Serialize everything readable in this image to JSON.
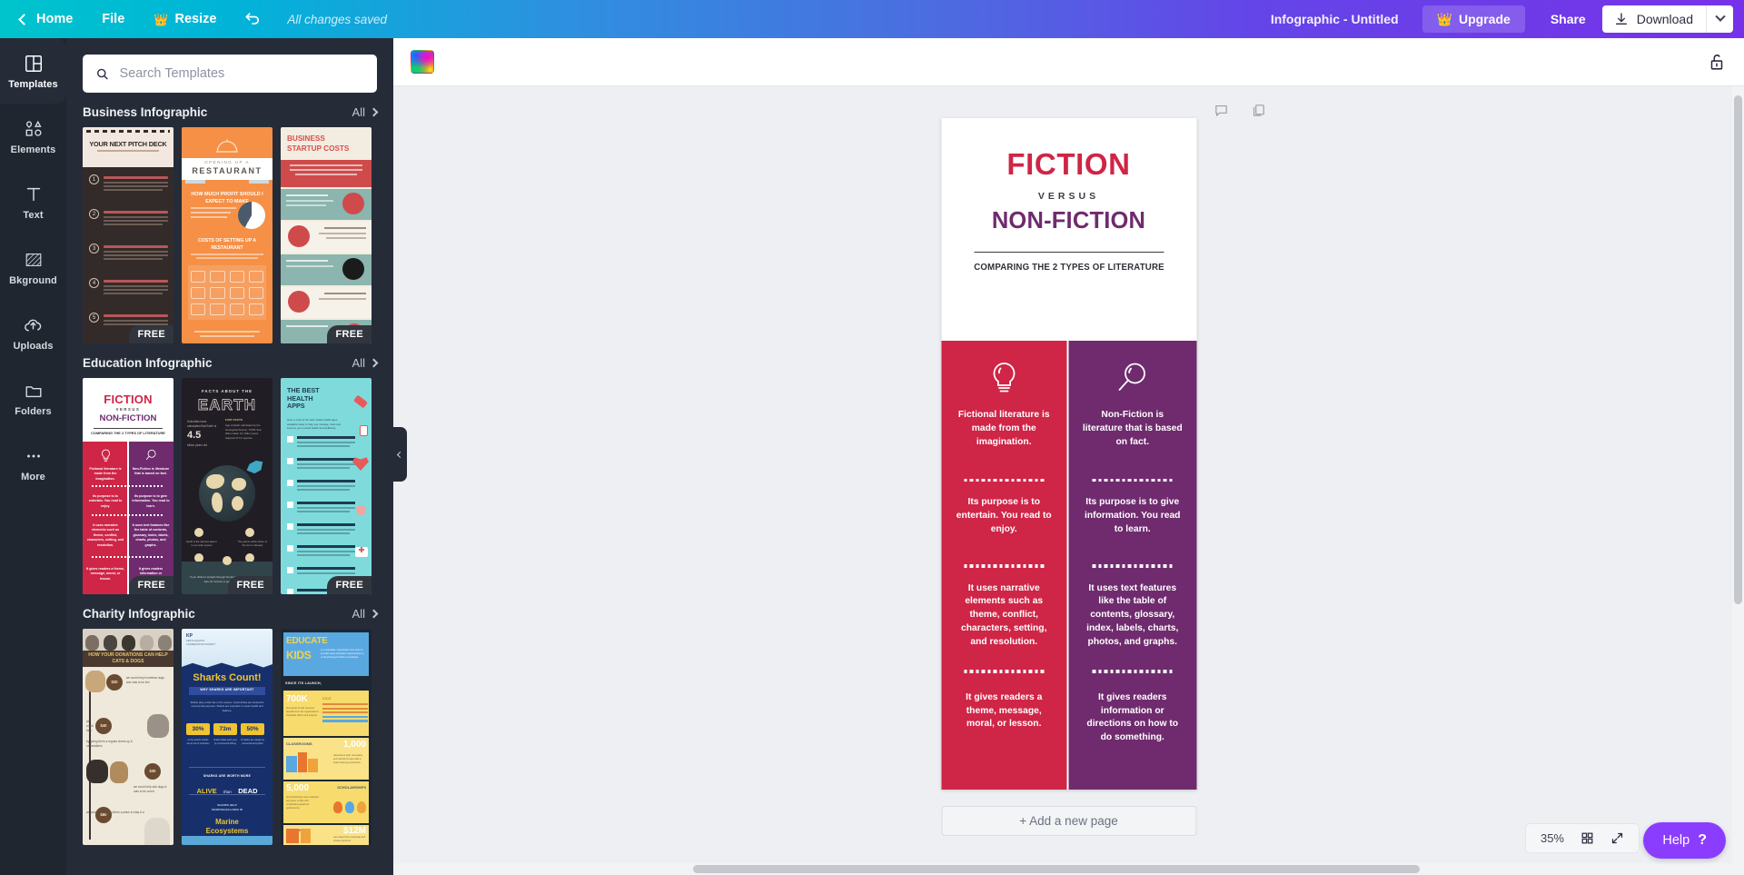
{
  "topbar": {
    "back_label": "Home",
    "file_label": "File",
    "resize_label": "Resize",
    "saved_status": "All changes saved",
    "doc_title": "Infographic - Untitled",
    "upgrade_label": "Upgrade",
    "share_label": "Share",
    "download_label": "Download",
    "gradient_start": "#00c4cc",
    "gradient_end": "#7632e8"
  },
  "rail": {
    "items": [
      {
        "label": "Templates",
        "icon": "templates-icon",
        "active": true
      },
      {
        "label": "Elements",
        "icon": "elements-icon",
        "active": false
      },
      {
        "label": "Text",
        "icon": "text-icon",
        "active": false
      },
      {
        "label": "Bkground",
        "icon": "background-icon",
        "active": false
      },
      {
        "label": "Uploads",
        "icon": "uploads-icon",
        "active": false
      },
      {
        "label": "Folders",
        "icon": "folders-icon",
        "active": false
      },
      {
        "label": "More",
        "icon": "more-icon",
        "active": false
      }
    ]
  },
  "panel": {
    "search": {
      "value": "",
      "placeholder": "Search Templates"
    },
    "all_label": "All",
    "free_badge": "FREE",
    "sections": [
      {
        "title": "Business Infographic",
        "templates": [
          {
            "name": "Your Next Pitch Deck",
            "free": true
          },
          {
            "name": "Opening Up A Restaurant",
            "free": false
          },
          {
            "name": "Business Startup Costs",
            "free": true
          }
        ]
      },
      {
        "title": "Education Infographic",
        "templates": [
          {
            "name": "Fiction Versus Non-Fiction",
            "free": true
          },
          {
            "name": "Facts About The Earth",
            "free": true
          },
          {
            "name": "The Best Health Apps",
            "free": true
          }
        ]
      },
      {
        "title": "Charity Infographic",
        "templates": [
          {
            "name": "How Your Donations Can Help Cats & Dogs",
            "free": false
          },
          {
            "name": "Sharks Count!",
            "free": false
          },
          {
            "name": "Educate Kids",
            "free": false
          }
        ]
      }
    ],
    "thumb_text": {
      "pitch_title": "YOUR NEXT PITCH DECK",
      "restaurant_title": "RESTAURANT",
      "restaurant_kicker": "OPENING UP A",
      "startup_title_1": "BUSINESS",
      "startup_title_2": "STARTUP COSTS",
      "fiction_title": "FICTION",
      "fiction_versus": "VERSUS",
      "fiction_non": "NON-FICTION",
      "fiction_sub": "COMPARING THE 2 TYPES OF LITERATURE",
      "earth_kicker": "FACTS ABOUT THE",
      "earth_title": "EARTH",
      "earth_value": "4.5",
      "health_title": "THE BEST\nHEALTH\nAPPS",
      "cats_title": "HOW YOUR DONATIONS CAN HELP CATS & DOGS",
      "sharks_title": "Sharks Count!",
      "sharks_sub": "WHY SHARKS ARE IMPORTANT",
      "sharks_stat1": "30%",
      "sharks_stat2": "73m",
      "sharks_stat3": "50%",
      "sharks_alive": "ALIVE",
      "sharks_than": "than",
      "sharks_dead": "DEAD",
      "sharks_marine": "Marine",
      "sharks_eco": "Ecosystems",
      "educate_1": "EDUCATE",
      "educate_2": "KIDS",
      "educate_since": "SINCE ITS LAUNCH,",
      "educate_700k": "700K",
      "educate_kids_lbl": "KIDS",
      "educate_class_lbl": "CLASSROOMS",
      "educate_1000": "1,000",
      "educate_5000": "5,000",
      "educate_schol_lbl": "SCHOLARSHIPS",
      "educate_don_lbl": "DONATION",
      "educate_12m": "$12M"
    }
  },
  "editor": {
    "color_swatch_name": "rainbow-gradient",
    "lock_icon": "unlock-icon"
  },
  "canvas": {
    "comment_icon": "comment-icon",
    "duplicate_icon": "duplicate-page-icon",
    "add_page_label": "+ Add a new page",
    "design": {
      "title_1": "FICTION",
      "title_versus": "VERSUS",
      "title_2": "NON-FICTION",
      "subtitle": "COMPARING THE 2 TYPES OF LITERATURE",
      "color_fiction": "#cf2546",
      "color_nonfiction": "#6f2b6e",
      "left_column": {
        "icon": "lightbulb-icon",
        "bg": "#cf2546",
        "points": [
          "Fictional literature is made from the imagination.",
          "Its purpose is to entertain. You read to enjoy.",
          "It uses narrative elements such as theme, conflict, characters, setting, and resolution.",
          "It gives readers a theme, message, moral, or lesson."
        ]
      },
      "right_column": {
        "icon": "magnifier-icon",
        "bg": "#6f2b6e",
        "points": [
          "Non-Fiction is literature that is based on fact.",
          "Its purpose is to give information. You read to learn.",
          "It uses text features like the table of contents, glossary, index, labels, charts, photos, and graphs.",
          "It gives readers information or directions on how to do something."
        ]
      }
    }
  },
  "footer": {
    "zoom_level": "35%",
    "grid_icon": "grid-view-icon",
    "expand_icon": "fit-screen-icon",
    "help_label": "Help",
    "help_mark": "?",
    "help_color": "#8b3dff"
  }
}
